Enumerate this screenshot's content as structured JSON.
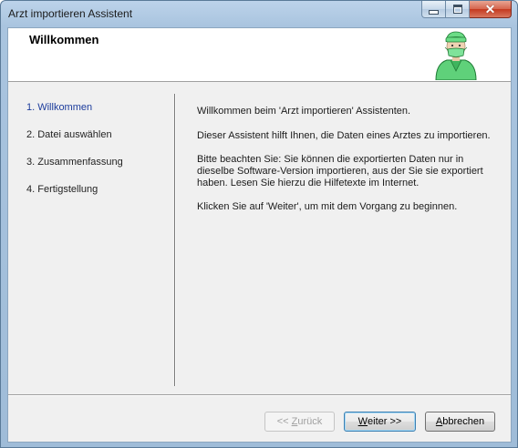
{
  "window": {
    "title": "Arzt importieren Assistent",
    "controls": {
      "minimize_icon": "minimize-icon",
      "maximize_icon": "maximize-icon",
      "close_icon": "close-icon"
    }
  },
  "header": {
    "title": "Willkommen",
    "image_icon": "doctor-icon"
  },
  "steps": [
    {
      "label": "1. Willkommen",
      "active": true
    },
    {
      "label": "2. Datei auswählen",
      "active": false
    },
    {
      "label": "3. Zusammenfassung",
      "active": false
    },
    {
      "label": "4. Fertigstellung",
      "active": false
    }
  ],
  "content": {
    "paragraph1": "Willkommen beim 'Arzt importieren' Assistenten.",
    "paragraph2": "Dieser Assistent hilft Ihnen, die Daten eines Arztes zu importieren.",
    "paragraph3": "Bitte beachten Sie: Sie können die exportierten Daten nur in dieselbe Software-Version importieren, aus der Sie sie exportiert haben. Lesen Sie hierzu die Hilfetexte im Internet.",
    "paragraph4": "Klicken Sie auf 'Weiter', um mit dem Vorgang zu beginnen."
  },
  "buttons": {
    "back": {
      "prefix": "<< ",
      "mnemonic": "Z",
      "rest": "urück",
      "enabled": false
    },
    "next": {
      "mnemonic": "W",
      "rest": "eiter >>",
      "enabled": true
    },
    "cancel": {
      "mnemonic": "A",
      "rest": "bbrechen",
      "enabled": true
    }
  },
  "colors": {
    "active_step": "#1c3c9c",
    "title_bar": "#a9c4df",
    "close_button": "#c4391f"
  }
}
